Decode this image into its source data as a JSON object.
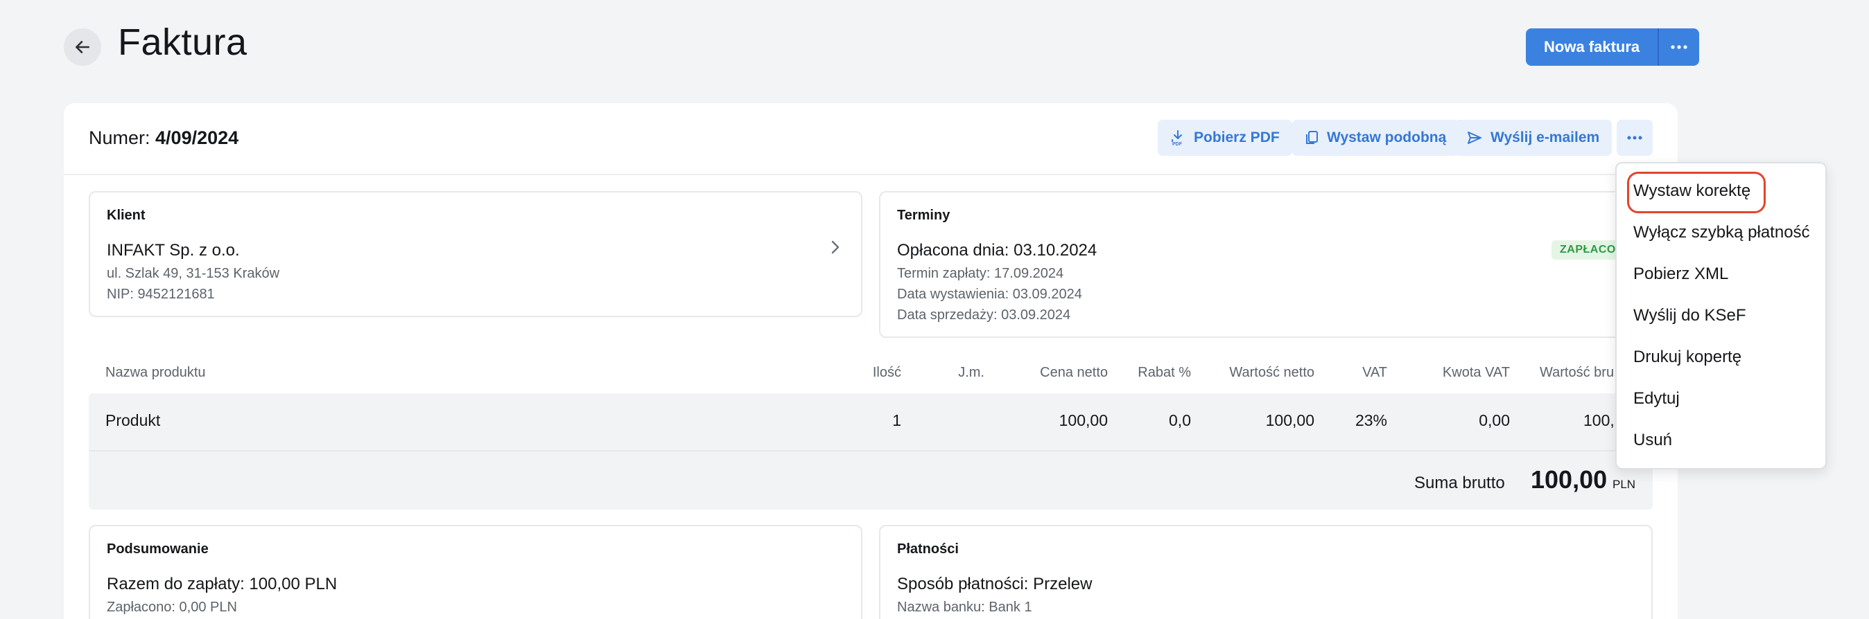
{
  "header": {
    "title": "Faktura",
    "primary_button": "Nowa faktura"
  },
  "invoice": {
    "number_label": "Numer:",
    "number_value": "4/09/2024"
  },
  "toolbar": {
    "download_pdf": "Pobierz PDF",
    "issue_similar": "Wystaw podobną",
    "send_email": "Wyślij e-mailem"
  },
  "client": {
    "title": "Klient",
    "name": "INFAKT Sp. z o.o.",
    "address": "ul. Szlak 49, 31-153 Kraków",
    "nip": "NIP: 9452121681"
  },
  "terms": {
    "title": "Terminy",
    "paid_on": "Opłacona dnia: 03.10.2024",
    "due": "Termin zapłaty: 17.09.2024",
    "issued": "Data wystawienia: 03.09.2024",
    "sold": "Data sprzedaży: 03.09.2024",
    "badge": "ZAPŁACON"
  },
  "table": {
    "headers": {
      "name": "Nazwa produktu",
      "qty": "Ilość",
      "unit": "J.m.",
      "net_price": "Cena netto",
      "discount": "Rabat %",
      "net_value": "Wartość netto",
      "vat": "VAT",
      "vat_amount": "Kwota VAT",
      "gross_value": "Wartość bru"
    },
    "row": {
      "name": "Produkt",
      "qty": "1",
      "unit": "",
      "net_price": "100,00",
      "discount": "0,0",
      "net_value": "100,00",
      "vat": "23%",
      "vat_amount": "0,00",
      "gross_value": "100,"
    },
    "sum_label": "Suma brutto",
    "sum_value": "100,00",
    "sum_currency": "PLN"
  },
  "summary": {
    "title": "Podsumowanie",
    "total": "Razem do zapłaty: 100,00 PLN",
    "paid": "Zapłacono: 0,00 PLN"
  },
  "payments": {
    "title": "Płatności",
    "method": "Sposób płatności: Przelew",
    "bank": "Nazwa banku: Bank 1"
  },
  "menu": {
    "items": [
      "Wystaw korektę",
      "Wyłącz szybką płatność",
      "Pobierz XML",
      "Wyślij do KSeF",
      "Drukuj kopertę",
      "Edytuj",
      "Usuń"
    ]
  },
  "colors": {
    "accent": "#3b82e0",
    "highlight": "#e2452c",
    "badge_green": "#2e9a44"
  }
}
